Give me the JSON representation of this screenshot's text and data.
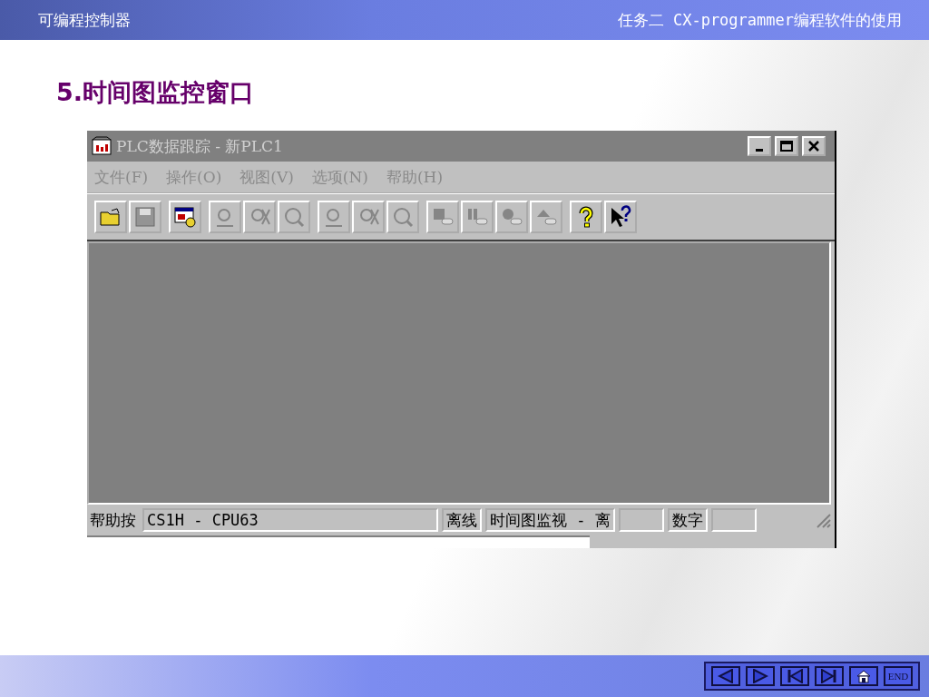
{
  "header": {
    "course": "可编程控制器",
    "task": "任务二 CX-programmer编程软件的使用"
  },
  "heading": "5.时间图监控窗口",
  "window": {
    "title": "PLC数据跟踪 - 新PLC1",
    "menu": [
      "文件(F)",
      "操作(O)",
      "视图(V)",
      "选项(N)",
      "帮助(H)"
    ],
    "toolbar": [
      [
        {
          "kind": "open",
          "disabled": false
        },
        {
          "kind": "save",
          "disabled": true
        }
      ],
      [
        {
          "kind": "config",
          "disabled": false
        }
      ],
      [
        {
          "kind": "trace",
          "disabled": true
        },
        {
          "kind": "trace-stop",
          "disabled": true
        },
        {
          "kind": "trace-read",
          "disabled": true
        }
      ],
      [
        {
          "kind": "zoom",
          "disabled": true
        },
        {
          "kind": "zoom-stop",
          "disabled": true
        },
        {
          "kind": "zoom-read",
          "disabled": true
        }
      ],
      [
        {
          "kind": "block",
          "disabled": true
        },
        {
          "kind": "pause",
          "disabled": true
        },
        {
          "kind": "gear",
          "disabled": true
        },
        {
          "kind": "eject",
          "disabled": true
        }
      ],
      [
        {
          "kind": "help",
          "disabled": false
        },
        {
          "kind": "context-help",
          "disabled": false
        }
      ]
    ],
    "status": [
      {
        "kind": "plain",
        "text": "帮助按"
      },
      {
        "kind": "pane",
        "text": "CS1H - CPU63",
        "wide": true
      },
      {
        "kind": "pane",
        "text": "离线"
      },
      {
        "kind": "pane",
        "text": "时间图监视 - 离"
      },
      {
        "kind": "empty"
      },
      {
        "kind": "pane",
        "text": "数字"
      },
      {
        "kind": "empty"
      }
    ]
  },
  "nav": [
    {
      "kind": "prev"
    },
    {
      "kind": "next"
    },
    {
      "kind": "first"
    },
    {
      "kind": "last"
    },
    {
      "kind": "home"
    },
    {
      "kind": "end",
      "text": "END"
    }
  ]
}
